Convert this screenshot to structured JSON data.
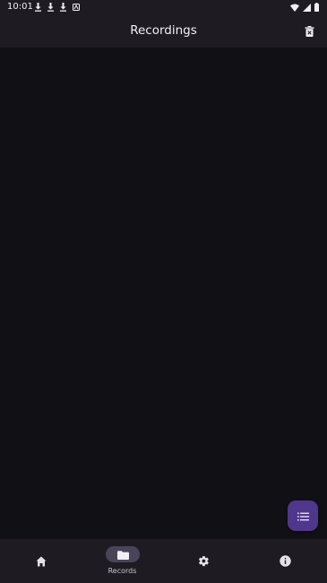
{
  "status_bar": {
    "time": "10:01",
    "notification_icons": [
      "download-icon",
      "download-icon",
      "download-icon",
      "app-notification-icon"
    ],
    "system_icons": [
      "wifi-icon",
      "signal-icon",
      "battery-icon"
    ]
  },
  "app_bar": {
    "title": "Recordings",
    "action_icon": "delete-icon"
  },
  "fab": {
    "icon": "list-icon",
    "color": "#4f378b"
  },
  "bottom_nav": {
    "items": [
      {
        "icon": "home-icon",
        "label": "",
        "active": false
      },
      {
        "icon": "folder-icon",
        "label": "Records",
        "active": true
      },
      {
        "icon": "gear-icon",
        "label": "",
        "active": false
      },
      {
        "icon": "info-icon",
        "label": "",
        "active": false
      }
    ],
    "active_indicator_color": "#4a4458"
  },
  "colors": {
    "background": "#111015",
    "surface": "#1e1c22",
    "text": "#f2eef7"
  }
}
